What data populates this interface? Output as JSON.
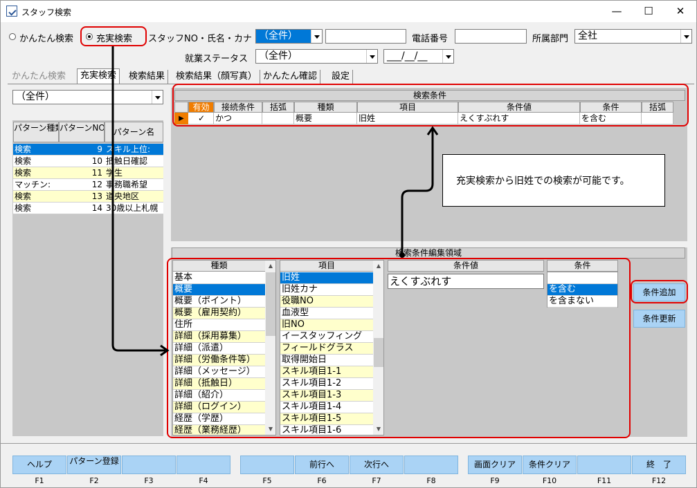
{
  "window": {
    "title": "スタッフ検索",
    "min": "—",
    "max": "☐",
    "close": "✕"
  },
  "search_mode": {
    "simple": "かんたん検索",
    "full": "充実検索"
  },
  "filters": {
    "staff_label": "スタッフNO・氏名・カナ",
    "staff_value": "（全件）",
    "phone_label": "電話番号",
    "dept_label": "所属部門",
    "dept_value": "全社",
    "status_label": "就業ステータス",
    "status_value": "（全件）",
    "date_value": "___/__/__"
  },
  "tabs": [
    "かんたん検索",
    "充実検索",
    "検索結果",
    "検索結果（顔写真）",
    "かんたん確認",
    "設定"
  ],
  "pattern": {
    "combo_value": "（全件）",
    "headers": [
      "パターン種類",
      "パターンNO",
      "パターン名"
    ],
    "rows": [
      {
        "type": "検索",
        "no": "9",
        "name": "スキル上位:"
      },
      {
        "type": "検索",
        "no": "10",
        "name": "抵触日確認"
      },
      {
        "type": "検索",
        "no": "11",
        "name": "学生"
      },
      {
        "type": "マッチン:",
        "no": "12",
        "name": "事務職希望"
      },
      {
        "type": "検索",
        "no": "13",
        "name": "道央地区"
      },
      {
        "type": "検索",
        "no": "14",
        "name": "30歳以上札幌"
      }
    ]
  },
  "conditions": {
    "title": "検索条件",
    "headers": [
      "有効",
      "接続条件",
      "括弧",
      "種類",
      "項目",
      "条件値",
      "条件",
      "括弧"
    ],
    "row": {
      "enabled": "✓",
      "conn": "かつ",
      "paren1": "",
      "kind": "概要",
      "item": "旧姓",
      "value": "えくすぶれす",
      "cond": "を含む",
      "paren2": ""
    }
  },
  "note": "充実検索から旧姓での検索が可能です。",
  "editor": {
    "title": "検索条件編集領域",
    "kind_header": "種類",
    "kinds": [
      "基本",
      "概要",
      "概要（ポイント）",
      "概要（雇用契約）",
      "住所",
      "詳細（採用募集）",
      "詳細（派遣）",
      "詳細（労働条件等）",
      "詳細（メッセージ）",
      "詳細（抵触日）",
      "詳細（紹介）",
      "詳細（ログイン）",
      "経歴（学歴）",
      "経歴（業務経歴）"
    ],
    "item_header": "項目",
    "items": [
      "旧姓",
      "旧姓カナ",
      "役職NO",
      "血液型",
      "旧NO",
      "イースタッフィング",
      "フィールドグラス",
      "取得開始日",
      "スキル項目1-1",
      "スキル項目1-2",
      "スキル項目1-3",
      "スキル項目1-4",
      "スキル項目1-5",
      "スキル項目1-6"
    ],
    "value_header": "条件値",
    "value": "えくすぶれす",
    "cond_header": "条件",
    "conds": [
      "",
      "を含む",
      "を含まない"
    ]
  },
  "buttons": {
    "add": "条件追加",
    "update": "条件更新"
  },
  "fkeys": [
    {
      "label": "ヘルプ",
      "key": "F1"
    },
    {
      "label": "パターン登録",
      "key": "F2"
    },
    {
      "label": "",
      "key": "F3"
    },
    {
      "label": "",
      "key": "F4"
    },
    {
      "label": "",
      "key": "F5"
    },
    {
      "label": "前行へ",
      "key": "F6"
    },
    {
      "label": "次行へ",
      "key": "F7"
    },
    {
      "label": "",
      "key": "F8"
    },
    {
      "label": "画面クリア",
      "key": "F9"
    },
    {
      "label": "条件クリア",
      "key": "F10"
    },
    {
      "label": "",
      "key": "F11"
    },
    {
      "label": "終　了",
      "key": "F12"
    }
  ],
  "colors": {
    "highlight": "#e00000",
    "button": "#aad3f5",
    "selected": "#0078d7",
    "row_alt": "#ffffcc"
  }
}
